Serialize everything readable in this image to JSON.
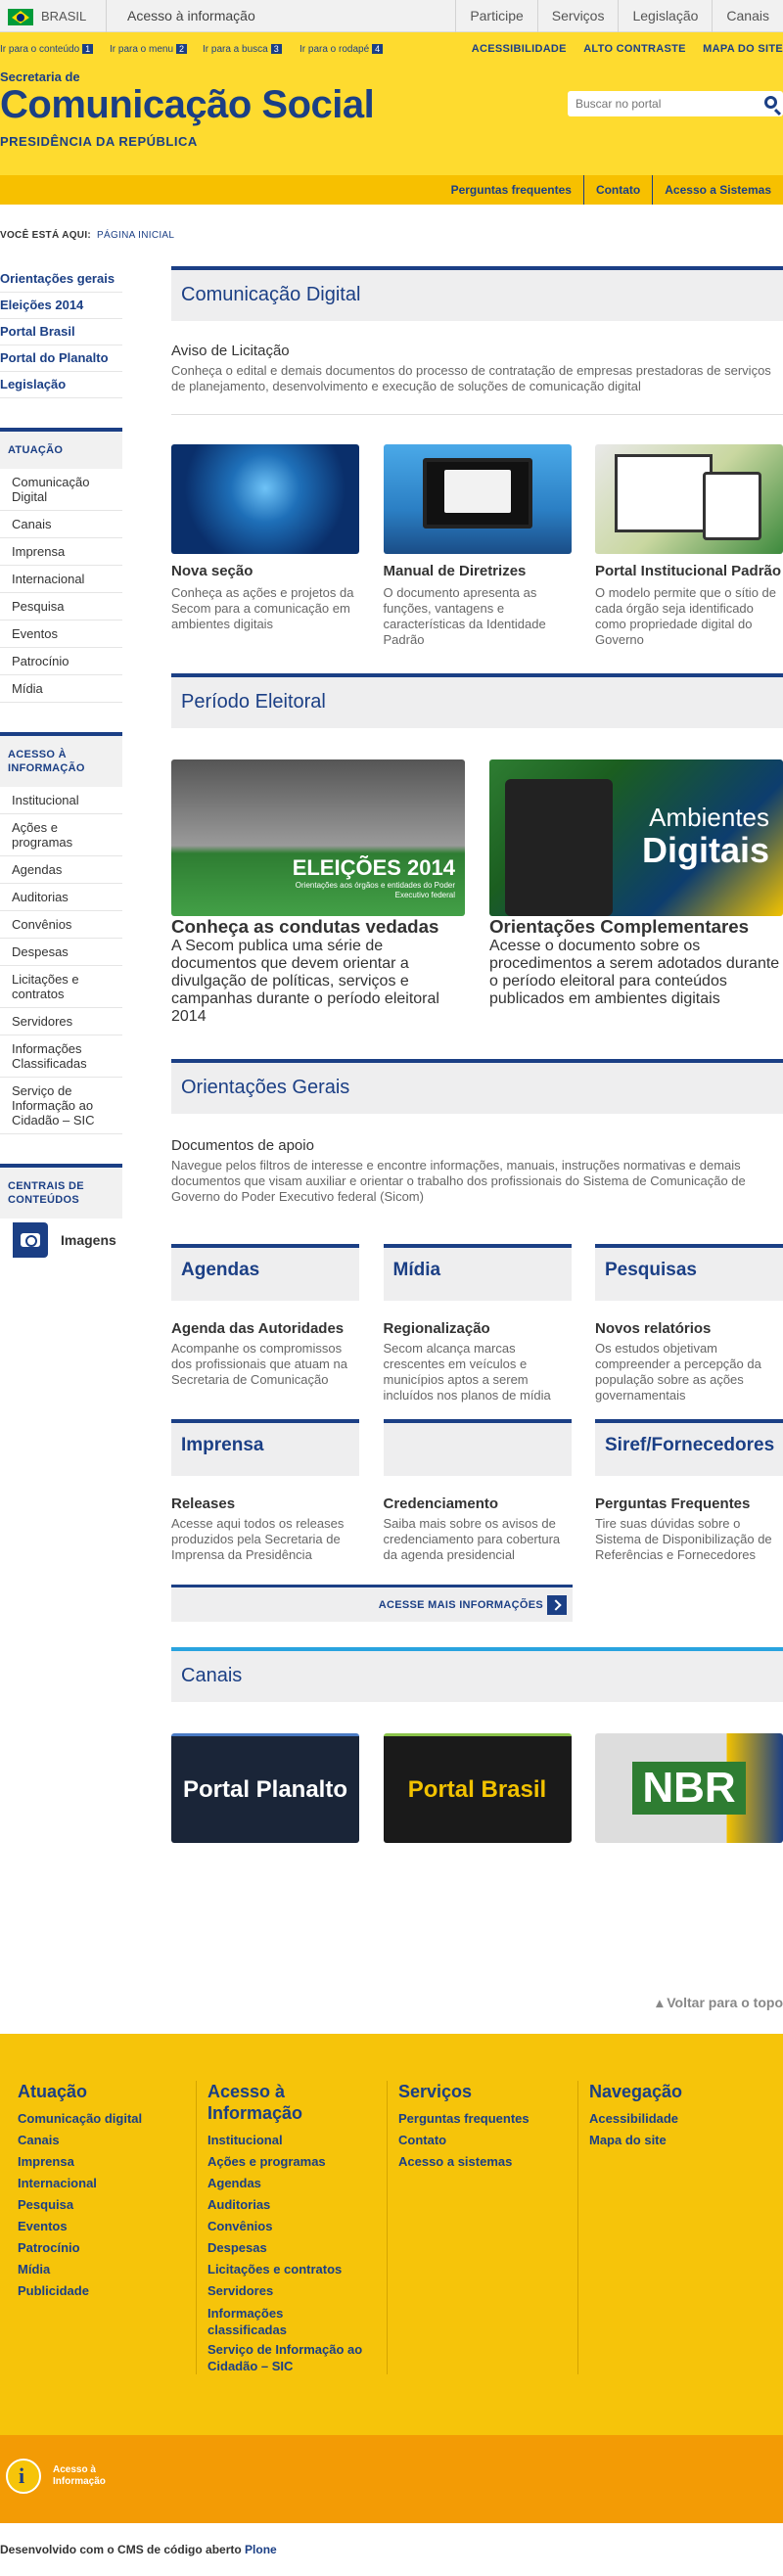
{
  "govbar": {
    "country": "BRASIL",
    "access": "Acesso à informação",
    "links": [
      "Participe",
      "Serviços",
      "Legislação",
      "Canais"
    ]
  },
  "accbar": {
    "skip": [
      {
        "label": "Ir para o conteúdo",
        "num": "1"
      },
      {
        "label": "Ir para o menu",
        "num": "2"
      },
      {
        "label": "Ir para a busca",
        "num": "3"
      },
      {
        "label": "Ir para o rodapé",
        "num": "4"
      }
    ],
    "right": [
      "ACESSIBILIDADE",
      "ALTO CONTRASTE",
      "MAPA DO SITE"
    ]
  },
  "brand": {
    "secretaria": "Secretaria de",
    "title": "Comunicação Social",
    "presidencia": "PRESIDÊNCIA DA REPÚBLICA"
  },
  "search": {
    "placeholder": "Buscar no portal"
  },
  "services": [
    "Perguntas frequentes",
    "Contato",
    "Acesso a Sistemas"
  ],
  "breadcrumb": {
    "label": "VOCÊ ESTÁ AQUI:",
    "home": "PÁGINA INICIAL"
  },
  "sidebar": {
    "top": [
      "Orientações gerais",
      "Eleições 2014",
      "Portal Brasil",
      "Portal do Planalto",
      "Legislação"
    ],
    "atuacao_head": "ATUAÇÃO",
    "atuacao": [
      "Comunicação Digital",
      "Canais",
      "Imprensa",
      "Internacional",
      "Pesquisa",
      "Eventos",
      "Patrocínio",
      "Mídia"
    ],
    "acesso_head": "ACESSO À INFORMAÇÃO",
    "acesso": [
      "Institucional",
      "Ações e programas",
      "Agendas",
      "Auditorias",
      "Convênios",
      "Despesas",
      "Licitações e contratos",
      "Servidores",
      "Informações Classificadas",
      "Serviço de Informação ao Cidadão – SIC"
    ],
    "centrais_head": "CENTRAIS DE CONTEÚDOS",
    "imagens": "Imagens"
  },
  "digital": {
    "head": "Comunicação Digital",
    "aviso_title": "Aviso de Licitação",
    "aviso_desc": "Conheça o edital e demais documentos do processo de contratação de empresas prestadoras de serviços de planejamento, desenvolvimento e execução de soluções de comunicação digital",
    "cards": [
      {
        "title": "Nova seção",
        "desc": "Conheça as ações e projetos da Secom para a comunicação em ambientes digitais"
      },
      {
        "title": "Manual de Diretrizes",
        "desc": "O documento apresenta as funções, vantagens e características da Identidade Padrão"
      },
      {
        "title": "Portal Institucional Padrão",
        "desc": "O modelo permite que o sítio de cada órgão seja identificado como propriedade digital do Governo"
      }
    ]
  },
  "eleitoral": {
    "head": "Período Eleitoral",
    "img1_text": "ELEIÇÕES 2014",
    "img1_sub": "Orientações aos órgãos e entidades do Poder Executivo federal",
    "img2_text1": "Ambientes",
    "img2_text2": "Digitais",
    "cards": [
      {
        "title": "Conheça as condutas vedadas",
        "desc": "A Secom publica uma série de documentos que devem orientar a divulgação de políticas, serviços e campanhas durante o período eleitoral 2014"
      },
      {
        "title": "Orientações Complementares",
        "desc": "Acesse o documento sobre os procedimentos a serem adotados durante o período eleitoral para conteúdos publicados em ambientes digitais"
      }
    ]
  },
  "orientacoes": {
    "head": "Orientações Gerais",
    "title": "Documentos de apoio",
    "desc": "Navegue pelos filtros de interesse e encontre informações, manuais, instruções normativas e demais documentos que visam auxiliar e orientar o trabalho dos profissionais do Sistema de Comunicação de Governo do Poder Executivo federal (Sicom)"
  },
  "boxes1": [
    {
      "head": "Agendas",
      "title": "Agenda das Autoridades",
      "desc": "Acompanhe os compromissos dos profissionais que atuam na Secretaria de Comunicação"
    },
    {
      "head": "Mídia",
      "title": "Regionalização",
      "desc": "Secom alcança marcas crescentes em veículos e municípios aptos a serem incluídos nos planos de mídia"
    },
    {
      "head": "Pesquisas",
      "title": "Novos relatórios",
      "desc": "Os estudos objetivam compreender a percepção da população sobre as ações governamentais"
    }
  ],
  "boxes2": [
    {
      "head": "Imprensa",
      "title": "Releases",
      "desc": "Acesse aqui todos os releases produzidos pela Secretaria de Imprensa da Presidência"
    },
    {
      "head": "",
      "title": "Credenciamento",
      "desc": "Saiba mais sobre os avisos de credenciamento para cobertura da agenda presidencial"
    },
    {
      "head": "Siref/Fornecedores",
      "title": "Perguntas Frequentes",
      "desc": "Tire suas dúvidas sobre o Sistema de Disponibilização de Referências e Fornecedores"
    }
  ],
  "more": "ACESSE MAIS INFORMAÇÕES",
  "canais": {
    "head": "Canais",
    "items": [
      "Portal Planalto",
      "Portal Brasil",
      "NBR"
    ]
  },
  "top_link": "Voltar para o topo",
  "footer": {
    "cols": [
      {
        "head": "Atuação",
        "links": [
          "Comunicação digital",
          "Canais",
          "Imprensa",
          "Internacional",
          "Pesquisa",
          "Eventos",
          "Patrocínio",
          "Mídia",
          "Publicidade"
        ]
      },
      {
        "head": "Acesso à Informação",
        "links": [
          "Institucional",
          "Ações e programas",
          "Agendas",
          "Auditorias",
          "Convênios",
          "Despesas",
          "Licitações e contratos",
          "Servidores",
          "Informações classificadas",
          "Serviço de Informação ao Cidadão – SIC"
        ]
      },
      {
        "head": "Serviços",
        "links": [
          "Perguntas frequentes",
          "Contato",
          "Acesso a sistemas"
        ]
      },
      {
        "head": "Navegação",
        "links": [
          "Acessibilidade",
          "Mapa do site"
        ]
      }
    ],
    "logo_text": "Acesso à Informação",
    "cms": "Desenvolvido com o CMS de código aberto",
    "plone": "Plone"
  },
  "colors": {
    "blue": "#1b3f85",
    "yellow": "#fedb2f",
    "gold": "#f6c40a",
    "orange": "#f39b05"
  }
}
